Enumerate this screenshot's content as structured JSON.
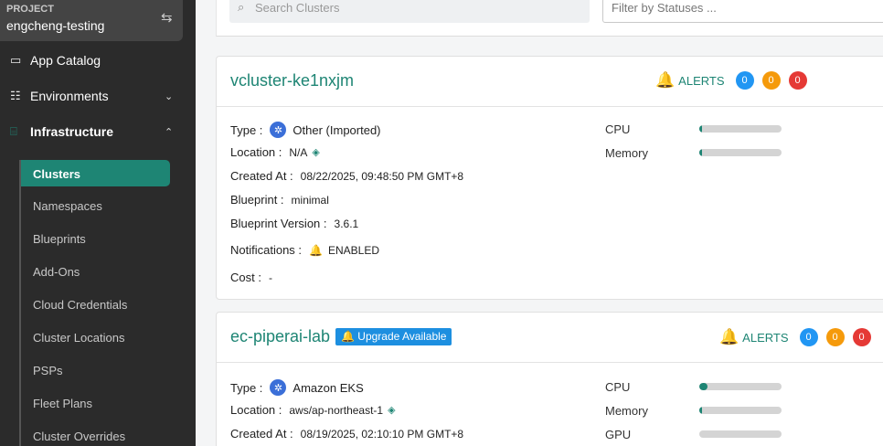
{
  "project": {
    "label": "PROJECT",
    "name": "engcheng-testing"
  },
  "nav": {
    "app_catalog": "App Catalog",
    "environments": "Environments",
    "infrastructure": "Infrastructure",
    "sub_items": [
      "Clusters",
      "Namespaces",
      "Blueprints",
      "Add-Ons",
      "Cloud Credentials",
      "Cluster Locations",
      "PSPs",
      "Fleet Plans",
      "Cluster Overrides"
    ]
  },
  "search": {
    "placeholder": "Search Clusters",
    "status_placeholder": "Filter by Statuses ..."
  },
  "colors": {
    "accent": "#1e8574",
    "sidebar": "#2b2b2b",
    "badge_blue": "#2196f3",
    "badge_orange": "#f59a0b",
    "badge_red": "#e53935",
    "upgrade": "#1d8fe0"
  },
  "labels": {
    "alerts": "ALERTS",
    "type": "Type :",
    "location": "Location :",
    "created_at": "Created At :",
    "blueprint": "Blueprint :",
    "blueprint_version": "Blueprint Version :",
    "notifications": "Notifications :",
    "cost": "Cost :",
    "cpu": "CPU",
    "memory": "Memory",
    "gpu": "GPU"
  },
  "clusters": [
    {
      "name": "vcluster-ke1nxjm",
      "alerts": [
        "0",
        "0",
        "0"
      ],
      "type": "Other (Imported)",
      "location": "N/A",
      "created_at": "08/22/2025, 09:48:50 PM GMT+8",
      "blueprint": "minimal",
      "blueprint_version": "3.6.1",
      "notifications": "ENABLED",
      "cost": "-",
      "cpu_usage": 0.01,
      "memory_usage": 0.01
    },
    {
      "name": "ec-piperai-lab",
      "upgrade_label": "Upgrade Available",
      "alerts": [
        "0",
        "0",
        "0"
      ],
      "type": "Amazon EKS",
      "location": "aws/ap-northeast-1",
      "created_at": "08/19/2025, 02:10:10 PM GMT+8",
      "cpu_usage": 0.1,
      "memory_usage": 0.02,
      "gpu_usage": 0
    }
  ]
}
